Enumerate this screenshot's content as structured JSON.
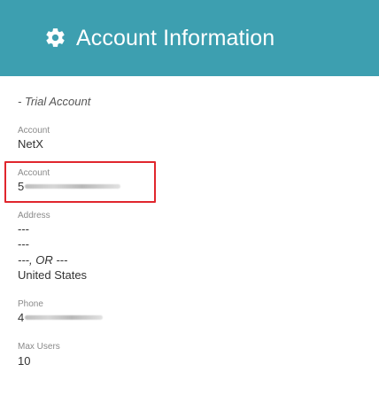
{
  "header": {
    "icon": "gear-icon",
    "title": "Account Information",
    "background": "#3d9fb0"
  },
  "account_type": "- Trial Account",
  "fields": {
    "account_name": {
      "label": "Account",
      "value": "NetX"
    },
    "account_number": {
      "label": "Account",
      "value_prefix": "5",
      "redacted": true
    },
    "address": {
      "label": "Address",
      "line1": "---",
      "line2": "---",
      "city_state": "---, OR ---",
      "country": "United States"
    },
    "phone": {
      "label": "Phone",
      "value_prefix": "4",
      "redacted": true
    },
    "max_users": {
      "label": "Max Users",
      "value": "10"
    }
  },
  "colors": {
    "highlight_border": "#e0262d",
    "label": "#8a8a8a",
    "text": "#333333"
  }
}
